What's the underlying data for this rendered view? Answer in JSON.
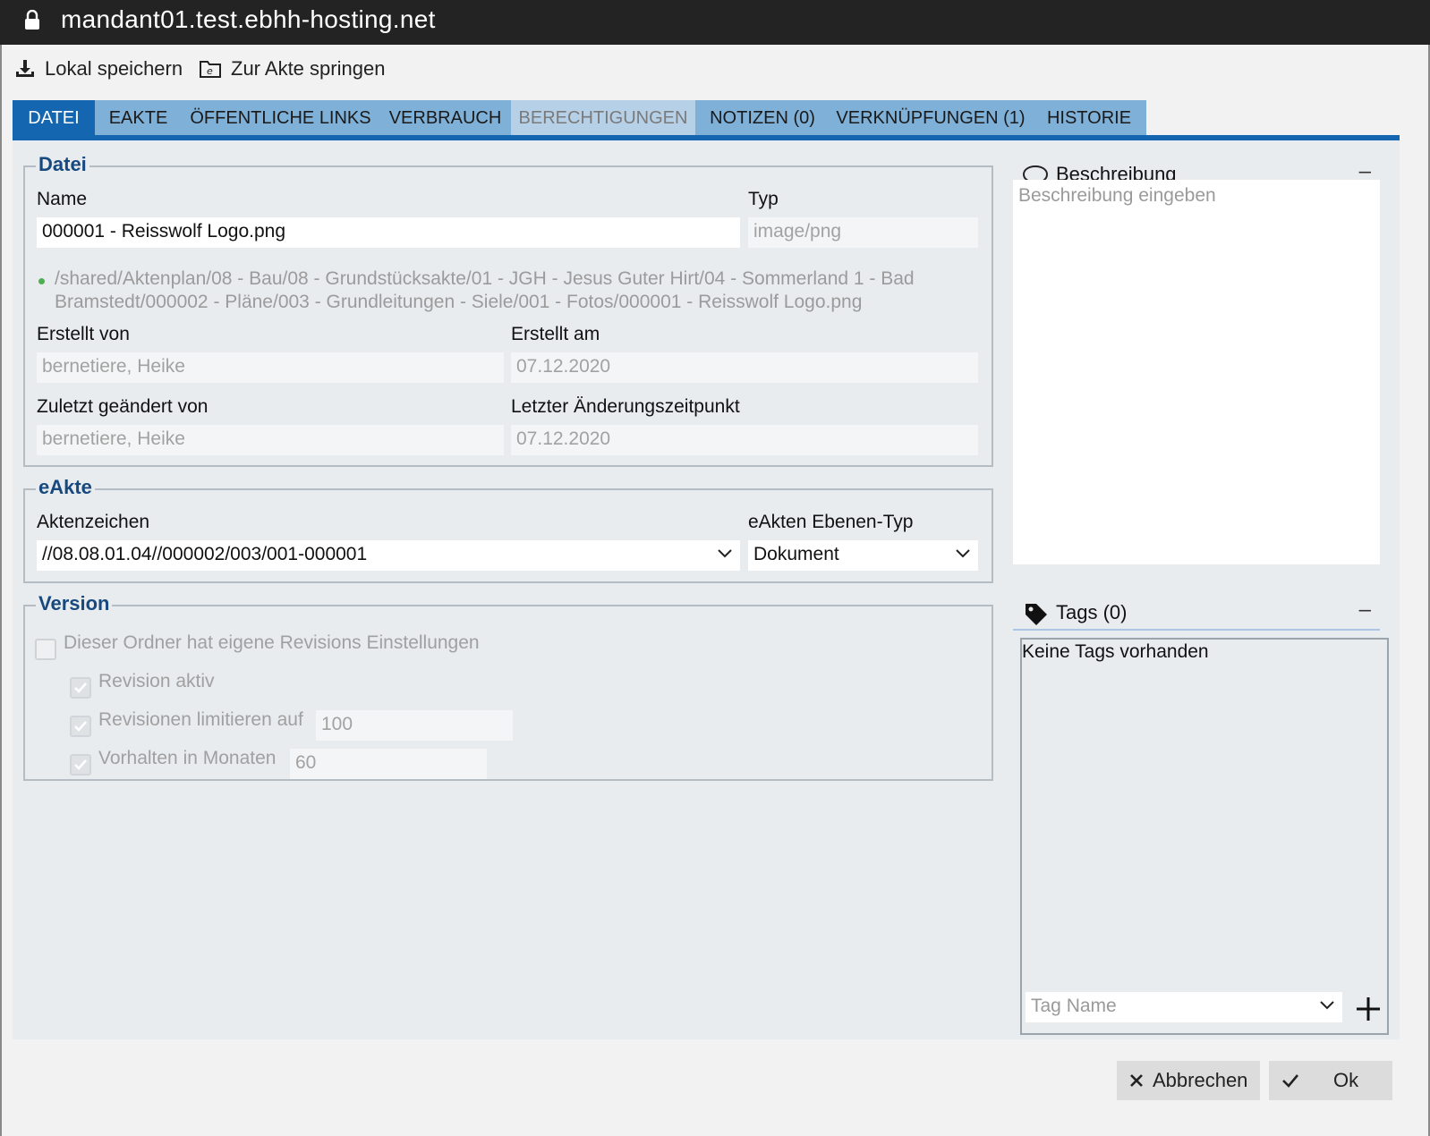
{
  "browser": {
    "url": "mandant01.test.ebhh-hosting.net"
  },
  "toolbar": {
    "save_local": "Lokal speichern",
    "jump_to_file": "Zur Akte springen"
  },
  "tabs": [
    {
      "label": "DATEI",
      "state": "active"
    },
    {
      "label": "EAKTE",
      "state": "normal"
    },
    {
      "label": "ÖFFENTLICHE LINKS",
      "state": "normal"
    },
    {
      "label": "VERBRAUCH",
      "state": "normal"
    },
    {
      "label": "BERECHTIGUNGEN",
      "state": "disabled"
    },
    {
      "label": "NOTIZEN (0)",
      "state": "normal"
    },
    {
      "label": "VERKNÜPFUNGEN (1)",
      "state": "normal"
    },
    {
      "label": "HISTORIE",
      "state": "normal"
    }
  ],
  "datei": {
    "legend": "Datei",
    "name_label": "Name",
    "name_value": "000001 - Reisswolf Logo.png",
    "type_label": "Typ",
    "type_value": "image/png",
    "path_line1": "/shared/Aktenplan/08 - Bau/08 - Grundstücksakte/01 - JGH - Jesus Guter Hirt/04 - Sommerland 1 - Bad",
    "path_line2": "Bramstedt/000002 - Pläne/003 - Grundleitungen - Siele/001 - Fotos/000001 - Reisswolf Logo.png",
    "created_by_label": "Erstellt von",
    "created_by_value": "bernetiere, Heike",
    "created_at_label": "Erstellt am",
    "created_at_value": "07.12.2020",
    "modified_by_label": "Zuletzt geändert von",
    "modified_by_value": "bernetiere, Heike",
    "modified_at_label": "Letzter Änderungszeitpunkt",
    "modified_at_value": "07.12.2020"
  },
  "eakte": {
    "legend": "eAkte",
    "aktenzeichen_label": "Aktenzeichen",
    "aktenzeichen_value": "//08.08.01.04//000002/003/001-000001",
    "level_type_label": "eAkten Ebenen-Typ",
    "level_type_value": "Dokument"
  },
  "version": {
    "legend": "Version",
    "own_settings_label": "Dieser Ordner hat eigene Revisions Einstellungen",
    "own_settings_checked": false,
    "revision_active_label": "Revision aktiv",
    "revision_active_checked": true,
    "limit_label": "Revisionen limitieren auf",
    "limit_checked": true,
    "limit_value": "100",
    "retain_label": "Vorhalten in Monaten",
    "retain_checked": true,
    "retain_value": "60"
  },
  "description": {
    "title": "Beschreibung",
    "collapse": "–",
    "placeholder": "Beschreibung eingeben"
  },
  "tags": {
    "title": "Tags (0)",
    "collapse": "–",
    "empty": "Keine Tags vorhanden",
    "input_placeholder": "Tag Name"
  },
  "footer": {
    "cancel": "Abbrechen",
    "ok": "Ok"
  },
  "colors": {
    "accent": "#1566b0",
    "tab": "#7fb0d8",
    "legend": "#17497f",
    "path_dot": "#4caf50"
  }
}
